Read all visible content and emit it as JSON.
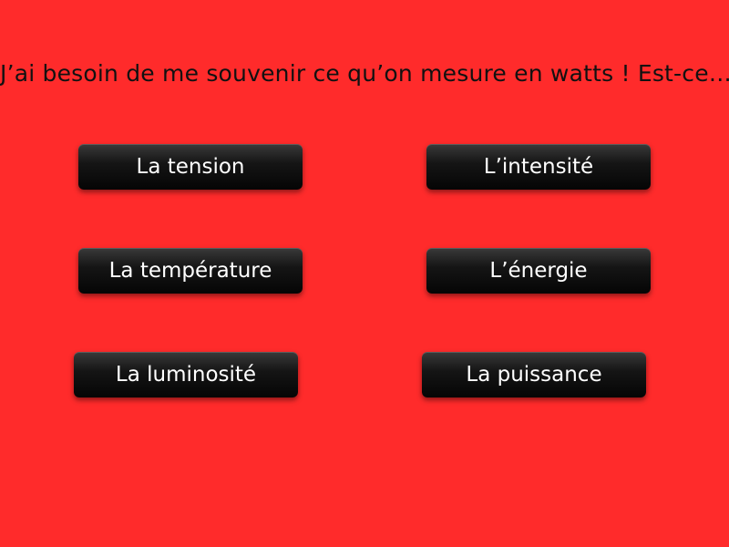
{
  "question": "J’ai besoin de me souvenir ce qu’on mesure en watts ! Est-ce…",
  "answers": [
    {
      "label": "La tension"
    },
    {
      "label": "L’intensité"
    },
    {
      "label": "La température"
    },
    {
      "label": "L’énergie"
    },
    {
      "label": "La luminosité"
    },
    {
      "label": "La puissance"
    }
  ],
  "colors": {
    "background": "#ff2b2b",
    "button": "#0a0a0a",
    "button_text": "#ffffff",
    "question_text": "#111111"
  }
}
